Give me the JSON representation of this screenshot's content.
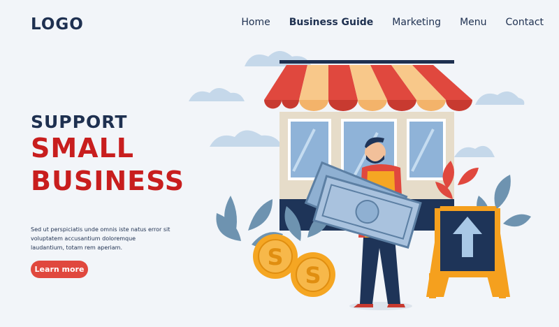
{
  "header": {
    "logo": "LOGO",
    "nav": [
      {
        "label": "Home"
      },
      {
        "label": "Business Guide"
      },
      {
        "label": "Marketing"
      },
      {
        "label": "Menu"
      },
      {
        "label": "Contact"
      }
    ]
  },
  "hero": {
    "title_line1": "SUPPORT",
    "title_line2": "SMALL",
    "title_line3": "BUSINESS",
    "body": "Sed ut perspiciatis unde omnis iste natus error sit voluptatem accusantium doloremque laudantium, totam rem aperiam.",
    "cta_label": "Learn more"
  },
  "colors": {
    "navy": "#1e3050",
    "red": "#c81e1e",
    "button": "#e0483e",
    "awning_red": "#e0483e",
    "awning_light": "#f8c88a",
    "coin": "#f5a623",
    "sign": "#f5a01e"
  }
}
